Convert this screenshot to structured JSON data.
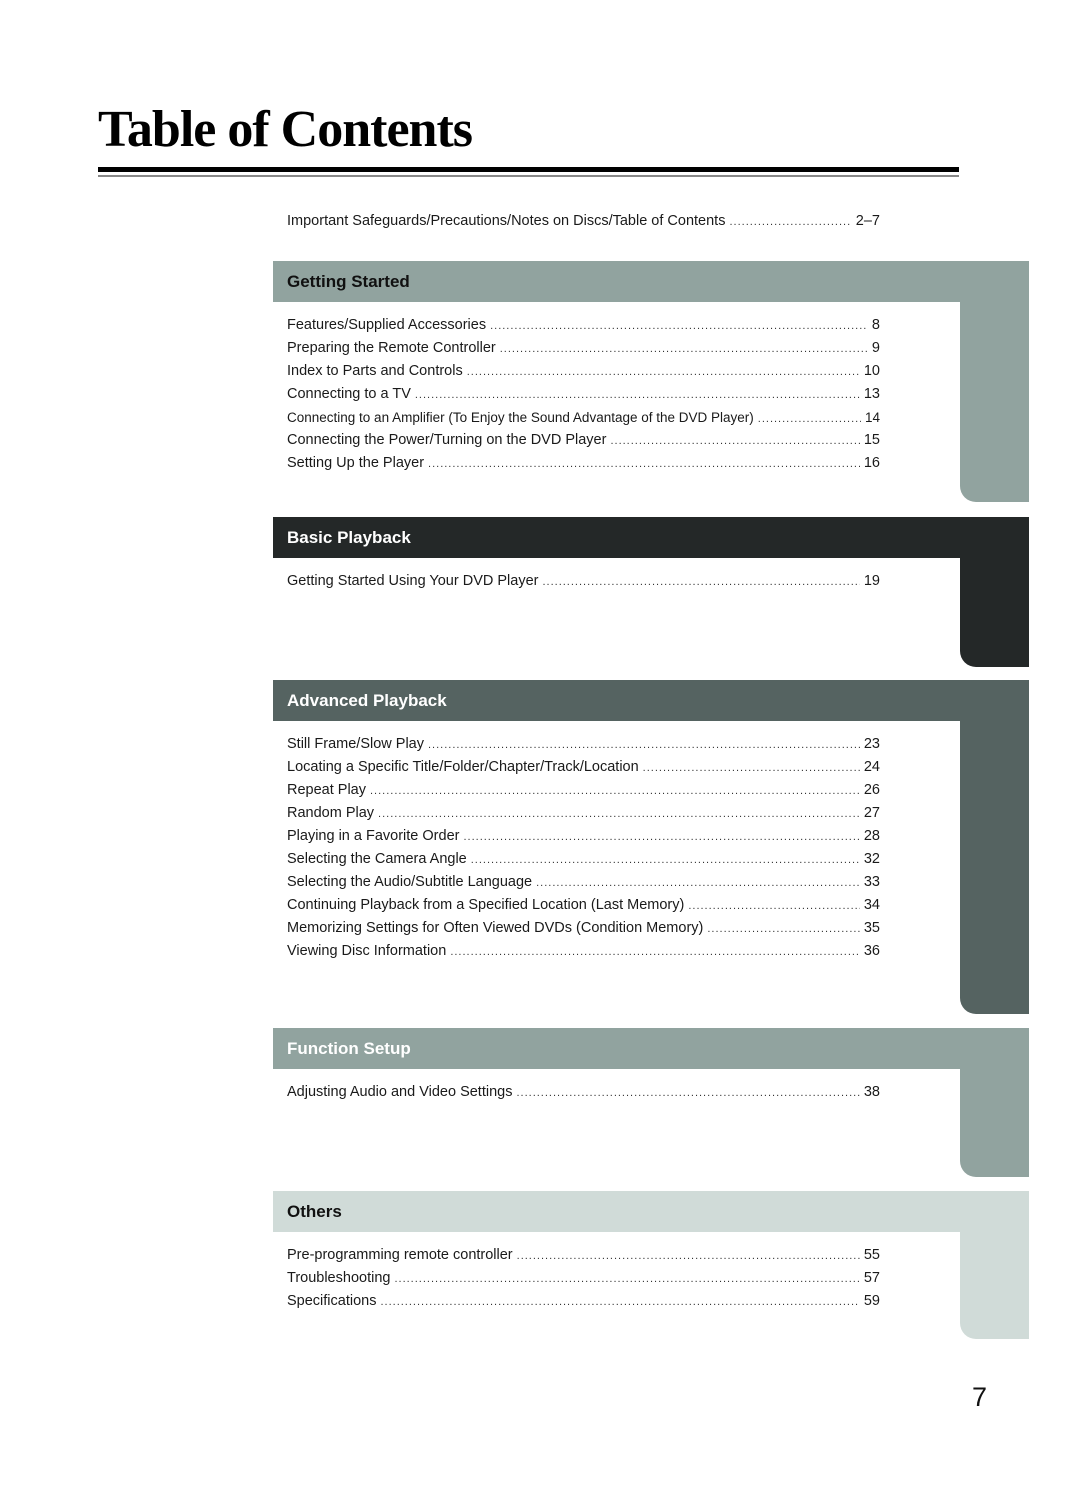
{
  "page": {
    "title": "Table of Contents",
    "page_number": "7"
  },
  "intro_entry": {
    "title": "Important Safeguards/Precautions/Notes on Discs/Table of Contents",
    "page": "2–7"
  },
  "colors": {
    "getting_started": "#91a39f",
    "basic_playback": "#242828",
    "advanced_playback": "#556361",
    "function_setup": "#91a39f",
    "others": "#d0dbd8"
  },
  "sections": [
    {
      "heading": "Getting Started",
      "entries": [
        {
          "title": "Features/Supplied Accessories",
          "page": "8"
        },
        {
          "title": "Preparing the Remote Controller",
          "page": "9"
        },
        {
          "title": "Index to Parts and Controls",
          "page": "10"
        },
        {
          "title": "Connecting to a TV",
          "page": "13"
        },
        {
          "title": "Connecting to an Amplifier (To Enjoy the Sound Advantage of the DVD Player)",
          "page": "14"
        },
        {
          "title": "Connecting the Power/Turning on the DVD Player",
          "page": "15"
        },
        {
          "title": "Setting Up the Player",
          "page": "16"
        }
      ]
    },
    {
      "heading": "Basic Playback",
      "entries": [
        {
          "title": "Getting Started Using Your DVD Player",
          "page": "19"
        }
      ]
    },
    {
      "heading": "Advanced Playback",
      "entries": [
        {
          "title": "Still Frame/Slow Play",
          "page": "23"
        },
        {
          "title": "Locating a Specific Title/Folder/Chapter/Track/Location",
          "page": "24"
        },
        {
          "title": "Repeat Play",
          "page": "26"
        },
        {
          "title": "Random Play",
          "page": "27"
        },
        {
          "title": "Playing in a Favorite Order",
          "page": "28"
        },
        {
          "title": "Selecting the Camera Angle",
          "page": "32"
        },
        {
          "title": "Selecting the Audio/Subtitle Language",
          "page": "33"
        },
        {
          "title": "Continuing Playback from a Specified Location (Last Memory)",
          "page": "34"
        },
        {
          "title": "Memorizing Settings for Often Viewed DVDs (Condition Memory)",
          "page": "35"
        },
        {
          "title": "Viewing Disc Information",
          "page": "36"
        }
      ]
    },
    {
      "heading": "Function Setup",
      "entries": [
        {
          "title": "Adjusting Audio and Video Settings",
          "page": "38"
        }
      ]
    },
    {
      "heading": "Others",
      "entries": [
        {
          "title": "Pre-programming remote controller",
          "page": "55"
        },
        {
          "title": "Troubleshooting",
          "page": "57"
        },
        {
          "title": "Specifications",
          "page": "59"
        }
      ]
    }
  ]
}
